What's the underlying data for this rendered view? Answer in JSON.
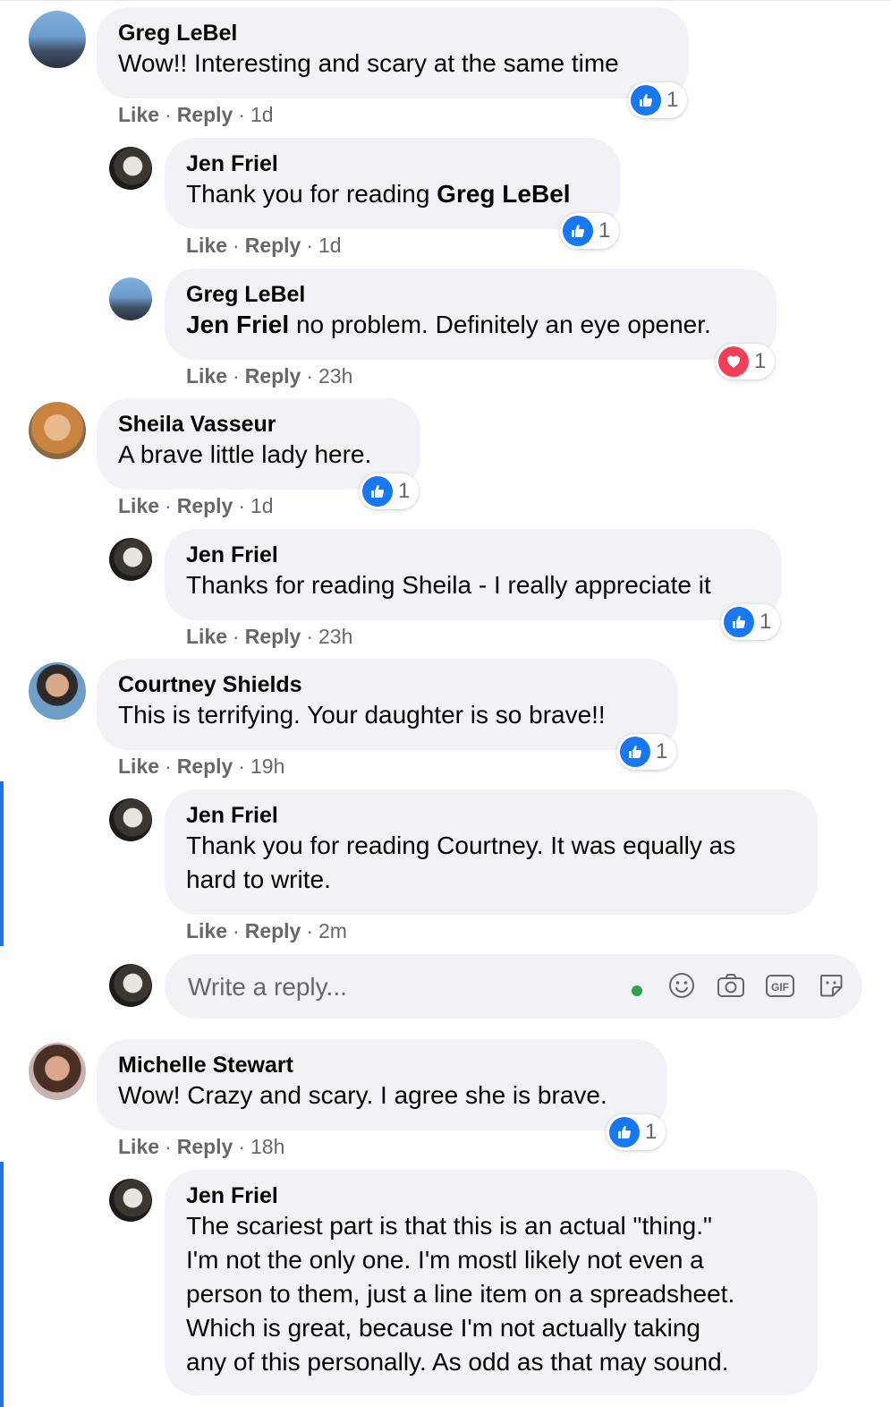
{
  "comments": [
    {
      "author": "Greg LeBel",
      "text": "Wow!! Interesting and scary at the same time",
      "time": "1d",
      "reaction": "like",
      "reaction_count": "1",
      "avatar": "greg-avatar"
    },
    {
      "author": "Jen Friel",
      "text_plain": "Thank you for reading ",
      "text_bold": "Greg LeBel",
      "time": "1d",
      "reaction": "like",
      "reaction_count": "1",
      "avatar": "jen-avatar"
    },
    {
      "author": "Greg LeBel",
      "text_bold": "Jen Friel",
      "text_plain": " no problem. Definitely an eye opener.",
      "time": "23h",
      "reaction": "love",
      "reaction_count": "1",
      "avatar": "greg-avatar"
    },
    {
      "author": "Sheila Vasseur",
      "text": "A brave little lady here.",
      "time": "1d",
      "reaction": "like",
      "reaction_count": "1",
      "avatar": "sheila-avatar"
    },
    {
      "author": "Jen Friel",
      "text": "Thanks for reading Sheila - I really appreciate it",
      "time": "23h",
      "reaction": "like",
      "reaction_count": "1",
      "avatar": "jen-avatar"
    },
    {
      "author": "Courtney Shields",
      "text": "This is terrifying. Your daughter is so brave!!",
      "time": "19h",
      "reaction": "like",
      "reaction_count": "1",
      "avatar": "courtney-avatar"
    },
    {
      "author": "Jen Friel",
      "text_line1": "Thank you for reading Courtney. It was equally as",
      "text_line2": "hard to write.",
      "time": "2m",
      "avatar": "jen-avatar"
    },
    {
      "author": "Michelle Stewart",
      "text": "Wow! Crazy and scary. I agree she is brave.",
      "time": "18h",
      "reaction": "like",
      "reaction_count": "1",
      "avatar": "michelle-avatar"
    },
    {
      "author": "Jen Friel",
      "lines": [
        "The scariest part is that this is an actual \"thing.\"",
        "I'm not the only one. I'm mostl likely not even a",
        "person to them, just a line item on a spreadsheet.",
        "Which is great, because I'm not actually taking",
        "any of this personally. As odd as that may sound."
      ],
      "avatar": "jen-avatar"
    }
  ],
  "labels": {
    "like": "Like",
    "reply": "Reply",
    "sep": "·"
  },
  "reply_box": {
    "placeholder": "Write a reply...",
    "icons": [
      "emoji-icon",
      "camera-icon",
      "gif-icon",
      "sticker-icon"
    ],
    "gif_text": "GIF"
  },
  "colors": {
    "bubble": "#f0f2f5",
    "meta": "#65676b",
    "like_blue": "#1877f2",
    "love_red": "#f33e58",
    "focus_bar": "#1b74e4",
    "online": "#31a24c"
  }
}
